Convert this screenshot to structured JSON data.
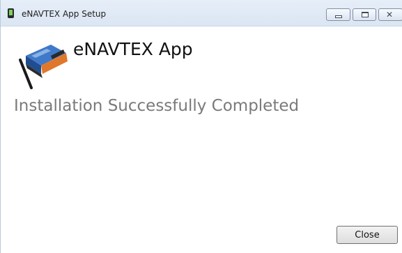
{
  "window": {
    "title": "eNAVTEX App Setup",
    "icon": "enavtex-app-icon",
    "controls": {
      "minimize_icon": "minimize-icon",
      "maximize_icon": "maximize-icon",
      "close_glyph": "✕"
    }
  },
  "header": {
    "logo_icon": "enavtex-device-icon",
    "title": "eNAVTEX App"
  },
  "main": {
    "status": "Installation Successfully Completed"
  },
  "footer": {
    "close_label": "Close"
  },
  "colors": {
    "titlebar": "#dbe6f3",
    "device_body": "#2f5fa8",
    "device_accent": "#e0782c",
    "status_text": "#7a7a7a"
  }
}
